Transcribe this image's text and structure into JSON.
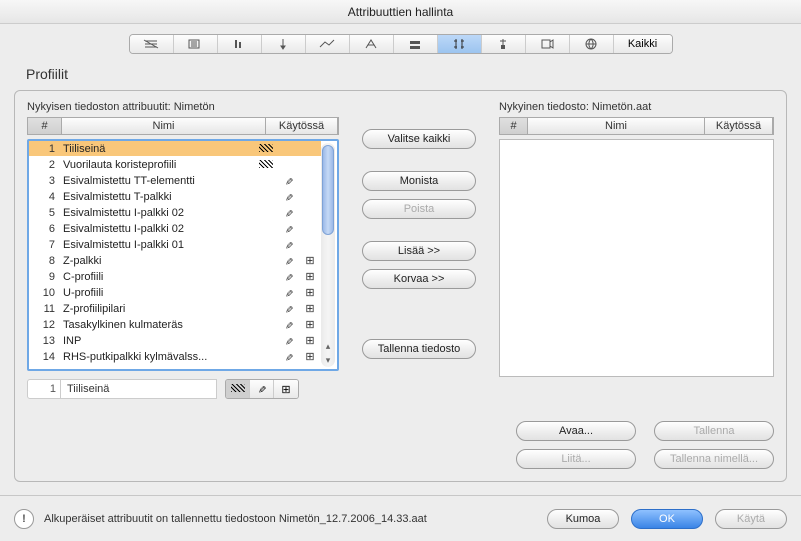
{
  "title": "Attribuuttien hallinta",
  "toolbar": {
    "all": "Kaikki"
  },
  "section": "Profiilit",
  "left": {
    "subtitle": "Nykyisen tiedoston attribuutit: Nimetön",
    "cols": {
      "num": "#",
      "name": "Nimi",
      "used": "Käytössä"
    },
    "items": [
      {
        "n": 1,
        "name": "Tiiliseinä",
        "icons": [
          "hatch"
        ],
        "selected": true
      },
      {
        "n": 2,
        "name": "Vuorilauta koristeprofiili",
        "icons": [
          "hatch"
        ]
      },
      {
        "n": 3,
        "name": "Esivalmistettu TT-elementti",
        "icons": [
          "link"
        ]
      },
      {
        "n": 4,
        "name": "Esivalmistettu T-palkki",
        "icons": [
          "link"
        ]
      },
      {
        "n": 5,
        "name": "Esivalmistettu I-palkki 02",
        "icons": [
          "link"
        ]
      },
      {
        "n": 6,
        "name": "Esivalmistettu I-palkki 02",
        "icons": [
          "link"
        ]
      },
      {
        "n": 7,
        "name": "Esivalmistettu I-palkki 01",
        "icons": [
          "link"
        ]
      },
      {
        "n": 8,
        "name": "Z-palkki",
        "icons": [
          "link",
          "grid"
        ]
      },
      {
        "n": 9,
        "name": "C-profiili",
        "icons": [
          "link",
          "grid"
        ]
      },
      {
        "n": 10,
        "name": "U-profiili",
        "icons": [
          "link",
          "grid"
        ]
      },
      {
        "n": 11,
        "name": "Z-profiilipilari",
        "icons": [
          "link",
          "grid"
        ]
      },
      {
        "n": 12,
        "name": "Tasakylkinen kulmateräs",
        "icons": [
          "link",
          "grid"
        ]
      },
      {
        "n": 13,
        "name": "INP",
        "icons": [
          "link",
          "grid"
        ]
      },
      {
        "n": 14,
        "name": "RHS-putkipalkki kylmävalss...",
        "icons": [
          "link",
          "grid"
        ]
      }
    ],
    "edit": {
      "num": "1",
      "name": "Tiiliseinä"
    }
  },
  "right": {
    "subtitle": "Nykyinen tiedosto: Nimetön.aat",
    "cols": {
      "num": "#",
      "name": "Nimi",
      "used": "Käytössä"
    }
  },
  "buttons": {
    "select_all": "Valitse kaikki",
    "duplicate": "Monista",
    "delete": "Poista",
    "add": "Lisää >>",
    "replace": "Korvaa >>",
    "save_file": "Tallenna tiedosto",
    "open": "Avaa...",
    "save": "Tallenna",
    "paste": "Liitä...",
    "save_as": "Tallenna nimellä..."
  },
  "footer": {
    "msg": "Alkuperäiset attribuutit on tallennettu tiedostoon Nimetön_12.7.2006_14.33.aat",
    "cancel": "Kumoa",
    "ok": "OK",
    "apply": "Käytä"
  }
}
